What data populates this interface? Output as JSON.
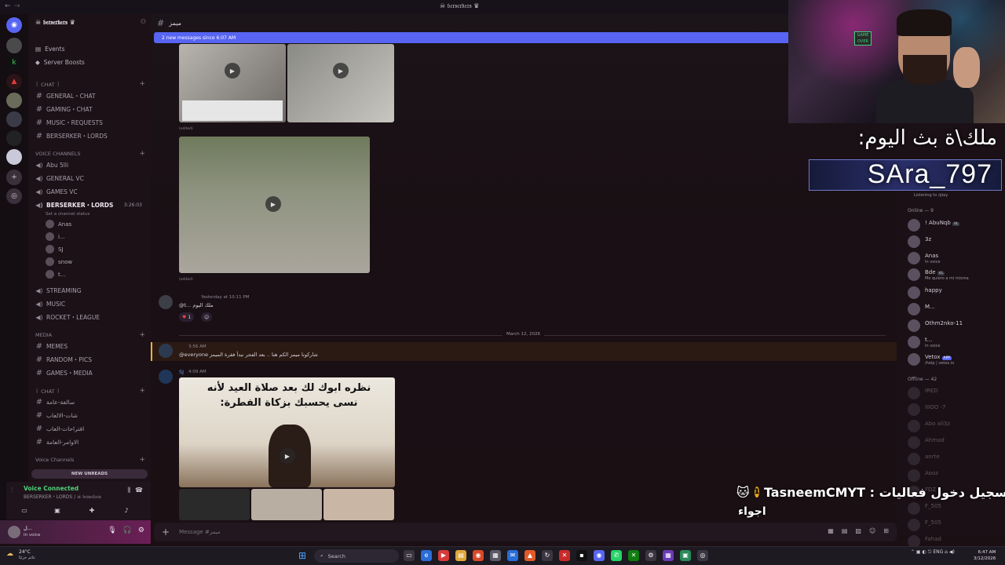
{
  "window": {
    "title": "☠ 𝔟𝔢𝔯𝔰𝔢𝔯𝔨𝔢𝔯𝔰 ♛"
  },
  "server": {
    "name": "☠ 𝔟𝔢𝔯𝔰𝔢𝔯𝔨𝔢𝔯𝔰 ♛",
    "nav": [
      "Events",
      "Server Boosts"
    ],
    "categories": [
      "꒰ CHAT ꒱",
      "VOICE CHANNELS",
      "MEDIA",
      "꒰ CHAT ꒱",
      "Voice Channels"
    ],
    "chat_channels": [
      "GENERAL・CHAT",
      "GAMING・CHAT",
      "MUSIC・REQUESTS",
      "BERSERKER・LORDS"
    ],
    "voice_channels": [
      "Abu 5lli",
      "GENERAL VC",
      "GAMES VC"
    ],
    "active_voice": {
      "name": "BERSERKER・LORDS",
      "timer": "3:26:03",
      "status": "Set a channel status"
    },
    "voice_users": [
      "Anas",
      "i...",
      "SJ",
      "snow",
      "t..."
    ],
    "more_voice": [
      "STREAMING",
      "MUSIC",
      "ROCKET・LEAGUE"
    ],
    "media_channels": [
      "MEMES",
      "RANDOM・PICS",
      "GAMES・MEDIA"
    ],
    "arabic_channels": [
      "سالفة-عامة",
      "شات-الالعاب",
      "اقتراحات-العاب",
      "الاوامر-العامة"
    ],
    "new_unreads": "NEW UNREADS"
  },
  "voice_status": {
    "label": "Voice Connected",
    "sub": "BERSERKER・LORDS / ☠ 𝔟𝔢𝔯𝔰𝔢𝔯𝔨𝔢𝔯𝔰"
  },
  "user": {
    "name": "ل...",
    "status": "In voice"
  },
  "chat": {
    "channel": "ميمز",
    "banner": "2 new messages since 6:07 AM",
    "edited": "(edited)",
    "msg1_time": "Yesterday at 10:11 PM",
    "msg1_text": "@t... ملك اليوم",
    "reaction_count": "1",
    "date_divider": "March 12, 2026",
    "msg2_time": "3:56 AM",
    "msg2_text": "@everyone شاركونا ميمز الكم هنا .. بعد الفجر نبدأ فقرة الميمز",
    "msg3_author": "SJ",
    "msg3_time": "4:09 AM",
    "meme_caption": "نظره ابوك لك بعد صلاة العيد لأنه نسى يحسبك بزكاة الفطرة:",
    "composer_placeholder": "Message #ميمز"
  },
  "members": {
    "listening": "Listening to /play",
    "online_header": "Online — 9",
    "online": [
      {
        "name": "! AbuNqb",
        "badge": "VL",
        "status": ""
      },
      {
        "name": "3z",
        "badge": "",
        "status": ""
      },
      {
        "name": "Anas",
        "badge": "",
        "status": "In voice"
      },
      {
        "name": "Bde",
        "badge": "VL",
        "status": "Me quiero a mi misma"
      },
      {
        "name": "happy",
        "badge": "",
        "status": ""
      },
      {
        "name": "M...",
        "badge": "",
        "status": ""
      },
      {
        "name": "Othm2nko-11",
        "badge": "",
        "status": ""
      },
      {
        "name": "t...",
        "badge": "",
        "status": "In voice"
      },
      {
        "name": "Vetox",
        "badge": "APP",
        "status": "/help | vetox.io"
      }
    ],
    "offline_header": "Offline — 42",
    "offline": [
      "IRED",
      "IIIOO -7",
      "Abo ali3z",
      "Ahmad",
      "anrte",
      "Aooz",
      "FDZ",
      "F_505",
      "F_505",
      "Fahad"
    ]
  },
  "overlay": {
    "title": "ملك\\ة بث اليوم:",
    "name": "SAra_797",
    "registration": "تسجيل دخول فعاليات : TasneemCMYT",
    "reg_number": "1",
    "message": "اجواء"
  },
  "cam": {
    "sign": "GAME OVER"
  },
  "taskbar": {
    "weather_temp": "24°C",
    "weather_desc": "غائم جزئيًا",
    "search": "Search",
    "lang": "ENG",
    "time": "6:47 AM",
    "date": "3/12/2026"
  },
  "colors": {
    "accent": "#5865f2",
    "voice_green": "#4fd17a",
    "mention_bg": "#3c3f7a"
  }
}
